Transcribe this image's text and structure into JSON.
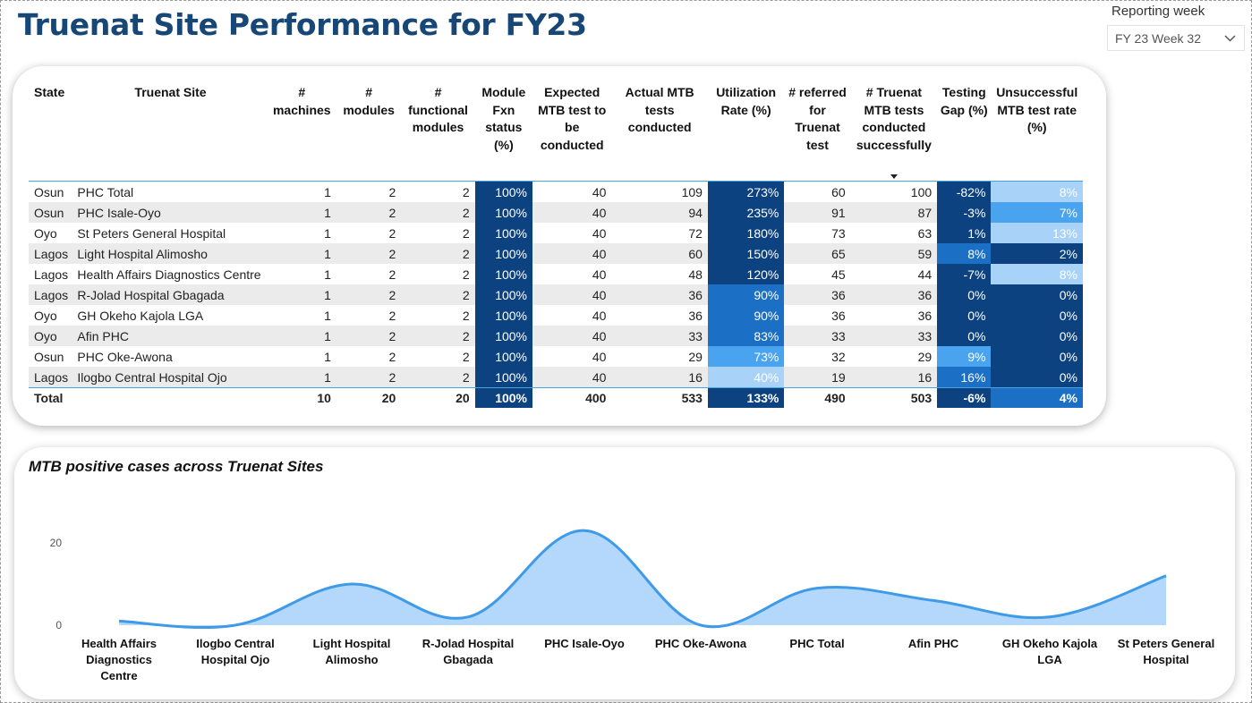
{
  "header": {
    "title": "Truenat Site Performance for FY23"
  },
  "slicer": {
    "label": "Reporting week",
    "value": "FY 23 Week 32"
  },
  "table": {
    "columns": [
      "State",
      "Truenat Site",
      "# machines",
      "# modules",
      "# functional modules",
      "Module Fxn status (%)",
      "Expected MTB test to be conducted",
      "Actual MTB tests conducted",
      "Utilization Rate (%)",
      "# referred for Truenat test",
      "# Truenat MTB tests conducted successfully",
      "Testing Gap (%)",
      "Unsuccessful MTB test rate (%)"
    ],
    "rows": [
      {
        "state": "Osun",
        "site": "PHC Total",
        "machines": "1",
        "modules": "2",
        "functional": "2",
        "fxn": "100%",
        "expected": "40",
        "actual": "109",
        "util": "273%",
        "referred": "60",
        "successful": "100",
        "gap": "-82%",
        "unsuccessful": "8%"
      },
      {
        "state": "Osun",
        "site": "PHC Isale-Oyo",
        "machines": "1",
        "modules": "2",
        "functional": "2",
        "fxn": "100%",
        "expected": "40",
        "actual": "94",
        "util": "235%",
        "referred": "91",
        "successful": "87",
        "gap": "-3%",
        "unsuccessful": "7%"
      },
      {
        "state": "Oyo",
        "site": "St Peters General Hospital",
        "machines": "1",
        "modules": "2",
        "functional": "2",
        "fxn": "100%",
        "expected": "40",
        "actual": "72",
        "util": "180%",
        "referred": "73",
        "successful": "63",
        "gap": "1%",
        "unsuccessful": "13%"
      },
      {
        "state": "Lagos",
        "site": "Light Hospital Alimosho",
        "machines": "1",
        "modules": "2",
        "functional": "2",
        "fxn": "100%",
        "expected": "40",
        "actual": "60",
        "util": "150%",
        "referred": "65",
        "successful": "59",
        "gap": "8%",
        "unsuccessful": "2%"
      },
      {
        "state": "Lagos",
        "site": "Health Affairs Diagnostics Centre",
        "machines": "1",
        "modules": "2",
        "functional": "2",
        "fxn": "100%",
        "expected": "40",
        "actual": "48",
        "util": "120%",
        "referred": "45",
        "successful": "44",
        "gap": "-7%",
        "unsuccessful": "8%"
      },
      {
        "state": "Lagos",
        "site": "R-Jolad Hospital Gbagada",
        "machines": "1",
        "modules": "2",
        "functional": "2",
        "fxn": "100%",
        "expected": "40",
        "actual": "36",
        "util": "90%",
        "referred": "36",
        "successful": "36",
        "gap": "0%",
        "unsuccessful": "0%"
      },
      {
        "state": "Oyo",
        "site": "GH Okeho Kajola LGA",
        "machines": "1",
        "modules": "2",
        "functional": "2",
        "fxn": "100%",
        "expected": "40",
        "actual": "36",
        "util": "90%",
        "referred": "36",
        "successful": "36",
        "gap": "0%",
        "unsuccessful": "0%"
      },
      {
        "state": "Oyo",
        "site": "Afin PHC",
        "machines": "1",
        "modules": "2",
        "functional": "2",
        "fxn": "100%",
        "expected": "40",
        "actual": "33",
        "util": "83%",
        "referred": "33",
        "successful": "33",
        "gap": "0%",
        "unsuccessful": "0%"
      },
      {
        "state": "Osun",
        "site": "PHC Oke-Awona",
        "machines": "1",
        "modules": "2",
        "functional": "2",
        "fxn": "100%",
        "expected": "40",
        "actual": "29",
        "util": "73%",
        "referred": "32",
        "successful": "29",
        "gap": "9%",
        "unsuccessful": "0%"
      },
      {
        "state": "Lagos",
        "site": "Ilogbo Central Hospital Ojo",
        "machines": "1",
        "modules": "2",
        "functional": "2",
        "fxn": "100%",
        "expected": "40",
        "actual": "16",
        "util": "40%",
        "referred": "19",
        "successful": "16",
        "gap": "16%",
        "unsuccessful": "0%"
      }
    ],
    "total": {
      "state": "Total",
      "machines": "10",
      "modules": "20",
      "functional": "20",
      "fxn": "100%",
      "expected": "400",
      "actual": "533",
      "util": "133%",
      "referred": "490",
      "successful": "503",
      "gap": "-6%",
      "unsuccessful": "4%"
    },
    "cell_colors": {
      "fxn": [
        "#0d4280",
        "#0d4280",
        "#0d4280",
        "#0d4280",
        "#0d4280",
        "#0d4280",
        "#0d4280",
        "#0d4280",
        "#0d4280",
        "#0d4280"
      ],
      "fxn_total": "#0d4280",
      "util": [
        "#0d4280",
        "#0d4280",
        "#0d4280",
        "#0d4280",
        "#0d4280",
        "#1b70c6",
        "#1b70c6",
        "#1b70c6",
        "#4aa3ef",
        "#a9d2f8"
      ],
      "util_total": "#0d4280",
      "gap": [
        "#0d4280",
        "#0d4280",
        "#0d4280",
        "#1b70c6",
        "#0d4280",
        "#0d4280",
        "#0d4280",
        "#0d4280",
        "#4aa3ef",
        "#1b70c6"
      ],
      "gap_total": "#0d4280",
      "unsuccessful": [
        "#a9d2f8",
        "#4aa3ef",
        "#a9d2f8",
        "#0d4280",
        "#a9d2f8",
        "#0d4280",
        "#0d4280",
        "#0d4280",
        "#0d4280",
        "#0d4280"
      ],
      "unsuccessful_total": "#1b70c6"
    }
  },
  "chart": {
    "title": "MTB positive cases across Truenat Sites"
  },
  "chart_data": {
    "type": "area",
    "title": "MTB positive cases across Truenat Sites",
    "categories": [
      "Health Affairs Diagnostics Centre",
      "Ilogbo Central Hospital Ojo",
      "Light Hospital Alimosho",
      "R-Jolad Hospital Gbagada",
      "PHC Isale-Oyo",
      "PHC Oke-Awona",
      "PHC Total",
      "Afin PHC",
      "GH Okeho Kajola LGA",
      "St Peters General Hospital"
    ],
    "category_lines": [
      [
        "Health Affairs",
        "Diagnostics",
        "Centre"
      ],
      [
        "Ilogbo Central",
        "Hospital Ojo"
      ],
      [
        "Light Hospital",
        "Alimosho"
      ],
      [
        "R-Jolad Hospital",
        "Gbagada"
      ],
      [
        "PHC Isale-Oyo"
      ],
      [
        "PHC Oke-Awona"
      ],
      [
        "PHC Total"
      ],
      [
        "Afin PHC"
      ],
      [
        "GH Okeho Kajola",
        "LGA"
      ],
      [
        "St Peters General",
        "Hospital"
      ]
    ],
    "values": [
      1,
      0,
      10,
      2,
      23,
      0,
      9,
      6,
      2,
      12
    ],
    "yticks": [
      0,
      20
    ],
    "ylim": [
      0,
      25
    ],
    "xlabel": "",
    "ylabel": "",
    "line_color": "#3f9ae8",
    "fill_color": "#b3d8fb",
    "grid": false,
    "legend": "none"
  }
}
